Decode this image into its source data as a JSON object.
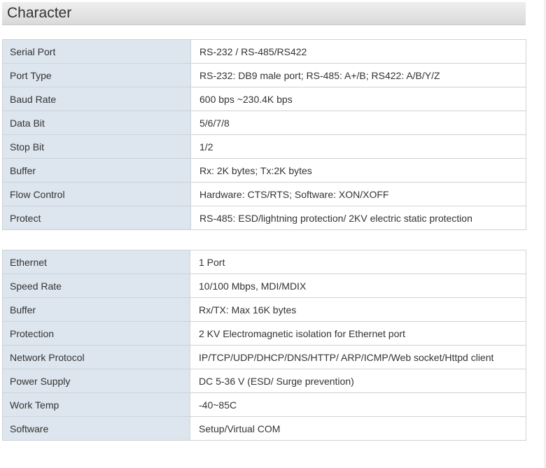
{
  "header": {
    "title": "Character"
  },
  "serial_table": {
    "rows": [
      {
        "label": "Serial Port",
        "value": "RS-232 / RS-485/RS422"
      },
      {
        "label": "Port Type",
        "value": "RS-232: DB9 male port; RS-485: A+/B; RS422: A/B/Y/Z"
      },
      {
        "label": "Baud Rate",
        "value": "600 bps ~230.4K bps"
      },
      {
        "label": "Data Bit",
        "value": "5/6/7/8"
      },
      {
        "label": "Stop Bit",
        "value": "1/2"
      },
      {
        "label": "Buffer",
        "value": "Rx: 2K bytes; Tx:2K bytes"
      },
      {
        "label": "Flow Control",
        "value": "Hardware: CTS/RTS; Software: XON/XOFF"
      },
      {
        "label": "Protect",
        "value": "RS-485: ESD/lightning protection/ 2KV electric static protection"
      }
    ]
  },
  "ethernet_table": {
    "rows": [
      {
        "label": "Ethernet",
        "value": "1 Port"
      },
      {
        "label": "Speed Rate",
        "value": "10/100 Mbps, MDI/MDIX"
      },
      {
        "label": "Buffer",
        "value": "Rx/TX: Max 16K bytes"
      },
      {
        "label": "Protection",
        "value": "2 KV Electromagnetic isolation for Ethernet port"
      },
      {
        "label": "Network Protocol",
        "value": "IP/TCP/UDP/DHCP/DNS/HTTP/ ARP/ICMP/Web socket/Httpd client"
      },
      {
        "label": "Power Supply",
        "value": "DC 5-36 V (ESD/ Surge prevention)"
      },
      {
        "label": "Work Temp",
        "value": "-40~85C"
      },
      {
        "label": "Software",
        "value": "Setup/Virtual COM"
      }
    ]
  },
  "colors": {
    "label_bg": "#dde5ee",
    "border": "#cdd3d8",
    "text": "#333333"
  }
}
